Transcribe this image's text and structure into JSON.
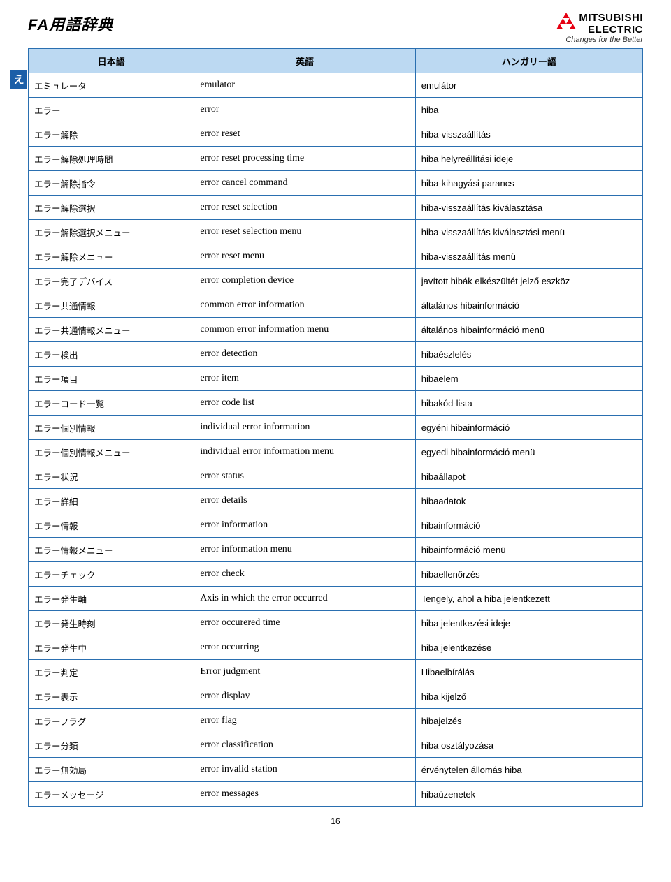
{
  "title": "FA用語辞典",
  "logo": {
    "name": "MITSUBISHI",
    "sub": "ELECTRIC",
    "tagline": "Changes for the Better"
  },
  "side_tab": "え",
  "headers": [
    "日本語",
    "英語",
    "ハンガリー語"
  ],
  "rows": [
    {
      "jp": "エミュレータ",
      "en": "emulator",
      "hu": "emulátor"
    },
    {
      "jp": "エラー",
      "en": "error",
      "hu": "hiba"
    },
    {
      "jp": "エラー解除",
      "en": "error reset",
      "hu": "hiba-visszaállítás"
    },
    {
      "jp": "エラー解除処理時間",
      "en": "error reset processing time",
      "hu": "hiba helyreállítási ideje"
    },
    {
      "jp": "エラー解除指令",
      "en": "error cancel command",
      "hu": "hiba-kihagyási parancs"
    },
    {
      "jp": "エラー解除選択",
      "en": "error reset selection",
      "hu": "hiba-visszaállítás kiválasztása"
    },
    {
      "jp": "エラー解除選択メニュー",
      "en": "error reset selection menu",
      "hu": "hiba-visszaállítás kiválasztási menü"
    },
    {
      "jp": "エラー解除メニュー",
      "en": "error reset menu",
      "hu": "hiba-visszaállítás menü"
    },
    {
      "jp": "エラー完了デバイス",
      "en": "error completion device",
      "hu": "javított hibák elkészültét jelző eszköz"
    },
    {
      "jp": "エラー共通情報",
      "en": "common error information",
      "hu": "általános hibainformáció"
    },
    {
      "jp": "エラー共通情報メニュー",
      "en": "common error information menu",
      "hu": "általános hibainformáció menü"
    },
    {
      "jp": "エラー検出",
      "en": "error detection",
      "hu": "hibaészlelés"
    },
    {
      "jp": "エラー項目",
      "en": "error item",
      "hu": "hibaelem"
    },
    {
      "jp": "エラーコード一覧",
      "en": "error code list",
      "hu": "hibakód-lista"
    },
    {
      "jp": "エラー個別情報",
      "en": "individual error information",
      "hu": "egyéni hibainformáció"
    },
    {
      "jp": "エラー個別情報メニュー",
      "en": "individual error information menu",
      "hu": "egyedi hibainformáció menü"
    },
    {
      "jp": "エラー状況",
      "en": "error status",
      "hu": "hibaállapot"
    },
    {
      "jp": "エラー詳細",
      "en": "error details",
      "hu": "hibaadatok"
    },
    {
      "jp": "エラー情報",
      "en": "error information",
      "hu": "hibainformáció"
    },
    {
      "jp": "エラー情報メニュー",
      "en": "error information menu",
      "hu": "hibainformáció menü"
    },
    {
      "jp": "エラーチェック",
      "en": "error check",
      "hu": "hibaellenőrzés"
    },
    {
      "jp": "エラー発生軸",
      "en": "Axis in which the error occurred",
      "hu": "Tengely, ahol a hiba jelentkezett"
    },
    {
      "jp": "エラー発生時刻",
      "en": "error occurered time",
      "hu": "hiba jelentkezési ideje"
    },
    {
      "jp": "エラー発生中",
      "en": "error occurring",
      "hu": "hiba jelentkezése"
    },
    {
      "jp": "エラー判定",
      "en": "Error judgment",
      "hu": "Hibaelbírálás"
    },
    {
      "jp": "エラー表示",
      "en": "error display",
      "hu": "hiba kijelző"
    },
    {
      "jp": "エラーフラグ",
      "en": "error flag",
      "hu": "hibajelzés"
    },
    {
      "jp": "エラー分類",
      "en": "error classification",
      "hu": "hiba osztályozása"
    },
    {
      "jp": "エラー無効局",
      "en": "error invalid station",
      "hu": "érvénytelen állomás hiba"
    },
    {
      "jp": "エラーメッセージ",
      "en": "error messages",
      "hu": "hibaüzenetek"
    }
  ],
  "page_number": "16"
}
